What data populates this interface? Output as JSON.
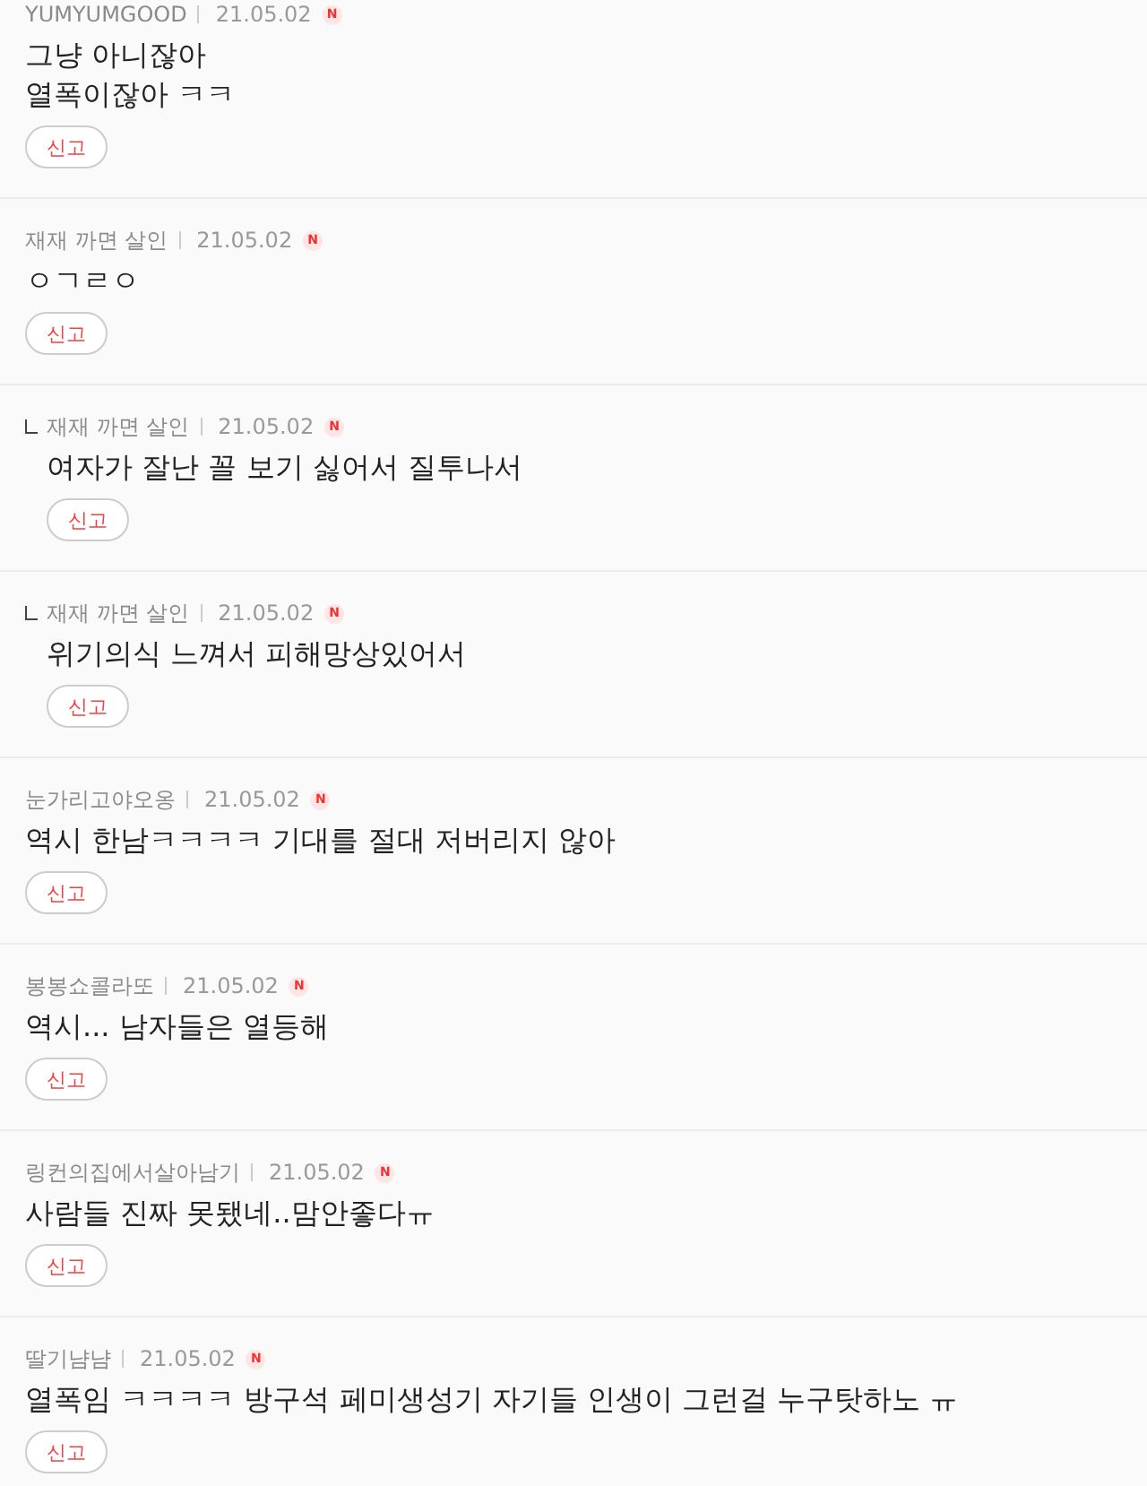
{
  "comments": [
    {
      "author": "YUMYUMGOOD",
      "date": "21.05.02",
      "badge": "N",
      "body": "그냥 아니잖아\n열폭이잖아 ㅋㅋ",
      "report_button": "신고"
    },
    {
      "author": "재재 까면 살인",
      "date": "21.05.02",
      "badge": "N",
      "body": "ㅇㄱㄹㅇ",
      "report_button": "신고",
      "children": [
        {
          "author": "재재 까면 살인",
          "date": "21.05.02",
          "badge": "N",
          "body": "여자가 잘난 꼴 보기 싫어서 질투나서",
          "report_button": "신고"
        },
        {
          "author": "재재 까면 살인",
          "date": "21.05.02",
          "badge": "N",
          "body": "위기의식 느껴서 피해망상있어서",
          "report_button": "신고"
        }
      ]
    },
    {
      "author": "눈가리고야오옹",
      "date": "21.05.02",
      "badge": "N",
      "body": "역시 한남ㅋㅋㅋㅋ 기대를 절대 저버리지 않아",
      "report_button": "신고"
    },
    {
      "author": "봉봉쇼콜라또",
      "date": "21.05.02",
      "badge": "N",
      "body": "역시... 남자들은 열등해",
      "report_button": "신고"
    },
    {
      "author": "링컨의집에서살아남기",
      "date": "21.05.02",
      "badge": "N",
      "body": "사람들 진짜 못됐네..맘안좋다ㅠ",
      "report_button": "신고"
    },
    {
      "author": "딸기냠냠",
      "date": "21.05.02",
      "badge": "N",
      "body": "열폭임 ㅋㅋㅋㅋ 방구석 페미생성기 자기들 인생이 그런걸 누구탓하노 ㅠ",
      "report_button": "신고"
    }
  ]
}
